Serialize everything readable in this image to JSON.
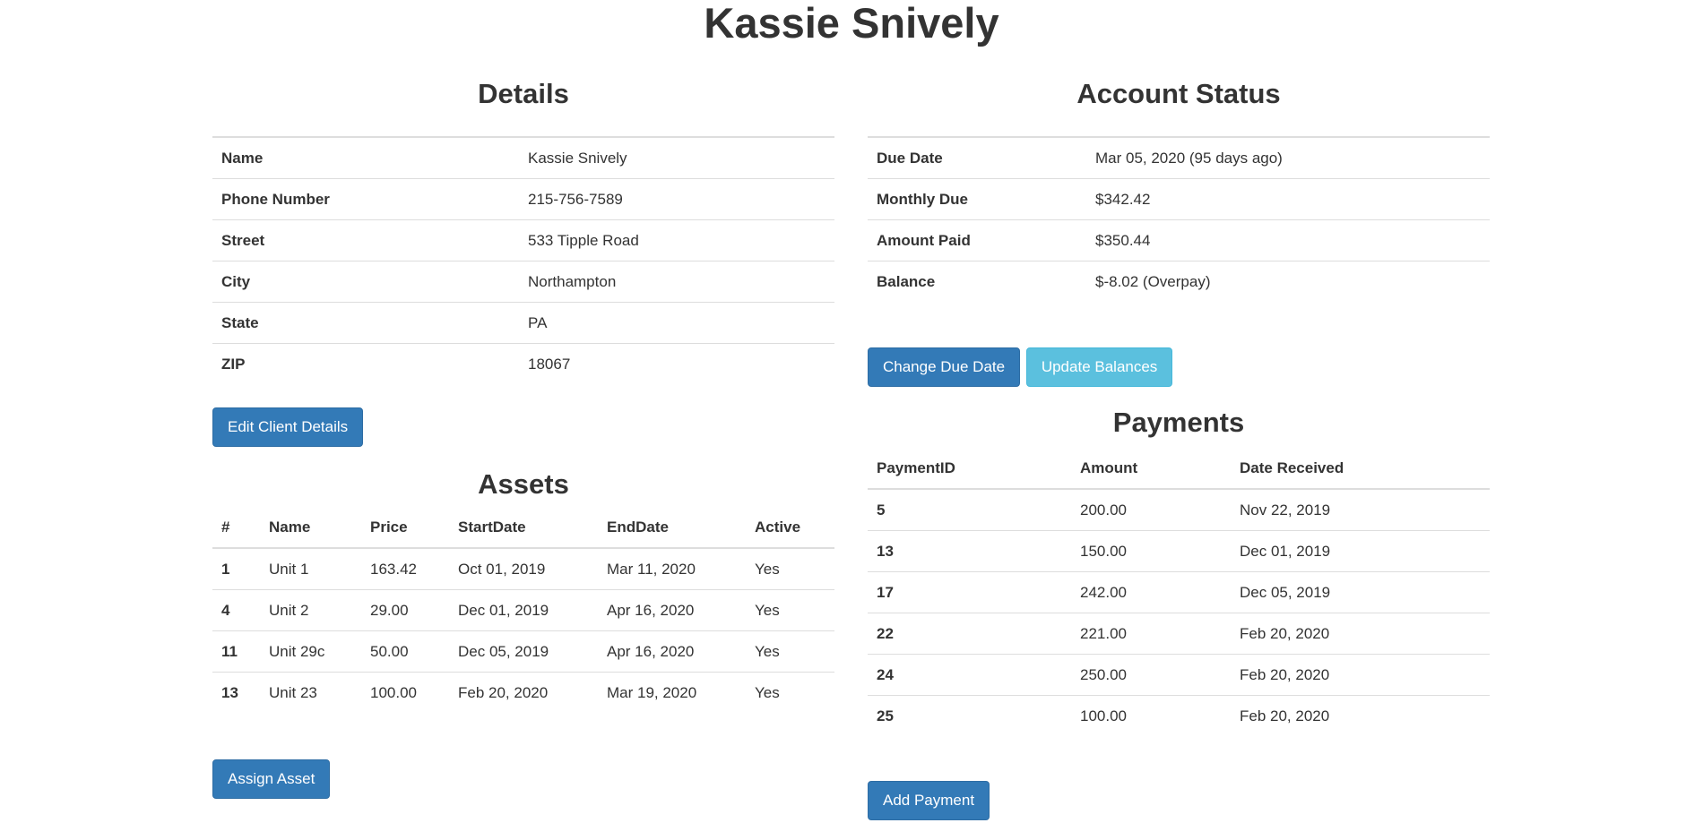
{
  "page": {
    "title": "Kassie Snively"
  },
  "details": {
    "heading": "Details",
    "rows": [
      {
        "label": "Name",
        "value": "Kassie Snively"
      },
      {
        "label": "Phone Number",
        "value": "215-756-7589"
      },
      {
        "label": "Street",
        "value": "533 Tipple Road"
      },
      {
        "label": "City",
        "value": "Northampton"
      },
      {
        "label": "State",
        "value": "PA"
      },
      {
        "label": "ZIP",
        "value": "18067"
      }
    ],
    "edit_button": "Edit Client Details"
  },
  "assets": {
    "heading": "Assets",
    "columns": [
      "#",
      "Name",
      "Price",
      "StartDate",
      "EndDate",
      "Active"
    ],
    "rows": [
      {
        "id": "1",
        "name": "Unit 1",
        "price": "163.42",
        "start": "Oct 01, 2019",
        "end": "Mar 11, 2020",
        "active": "Yes"
      },
      {
        "id": "4",
        "name": "Unit 2",
        "price": "29.00",
        "start": "Dec 01, 2019",
        "end": "Apr 16, 2020",
        "active": "Yes"
      },
      {
        "id": "11",
        "name": "Unit 29c",
        "price": "50.00",
        "start": "Dec 05, 2019",
        "end": "Apr 16, 2020",
        "active": "Yes"
      },
      {
        "id": "13",
        "name": "Unit 23",
        "price": "100.00",
        "start": "Feb 20, 2020",
        "end": "Mar 19, 2020",
        "active": "Yes"
      }
    ],
    "assign_button": "Assign Asset"
  },
  "account_status": {
    "heading": "Account Status",
    "rows": [
      {
        "label": "Due Date",
        "value": "Mar 05, 2020 (95 days ago)"
      },
      {
        "label": "Monthly Due",
        "value": "$342.42"
      },
      {
        "label": "Amount Paid",
        "value": "$350.44"
      },
      {
        "label": "Balance",
        "value": "$-8.02 (Overpay)"
      }
    ],
    "change_due_button": "Change Due Date",
    "update_balances_button": "Update Balances"
  },
  "payments": {
    "heading": "Payments",
    "columns": [
      "PaymentID",
      "Amount",
      "Date Received"
    ],
    "rows": [
      {
        "id": "5",
        "amount": "200.00",
        "date": "Nov 22, 2019"
      },
      {
        "id": "13",
        "amount": "150.00",
        "date": "Dec 01, 2019"
      },
      {
        "id": "17",
        "amount": "242.00",
        "date": "Dec 05, 2019"
      },
      {
        "id": "22",
        "amount": "221.00",
        "date": "Feb 20, 2020"
      },
      {
        "id": "24",
        "amount": "250.00",
        "date": "Feb 20, 2020"
      },
      {
        "id": "25",
        "amount": "100.00",
        "date": "Feb 20, 2020"
      }
    ],
    "add_button": "Add Payment"
  },
  "colors": {
    "primary": "#337ab7",
    "info": "#5bc0de",
    "text": "#333333",
    "border": "#dddddd"
  }
}
